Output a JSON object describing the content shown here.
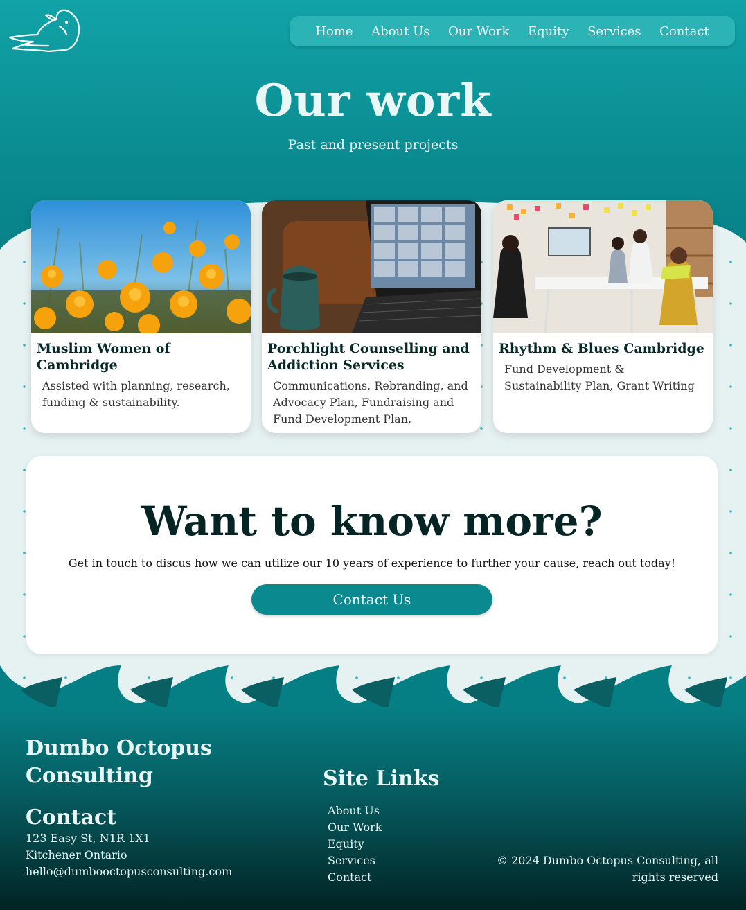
{
  "brand": "Dumbo Octopus Consulting",
  "nav": {
    "items": [
      {
        "label": "Home"
      },
      {
        "label": "About Us"
      },
      {
        "label": "Our Work"
      },
      {
        "label": "Equity"
      },
      {
        "label": "Services"
      },
      {
        "label": "Contact"
      }
    ]
  },
  "hero": {
    "title": "Our work",
    "subtitle": "Past and present projects"
  },
  "projects": [
    {
      "title": "Muslim Women of Cambridge",
      "description": "Assisted with planning, research, funding & sustainability.",
      "image_icon": "flowers-photo"
    },
    {
      "title": "Porchlight Counselling and Addiction Services",
      "description": "Communications, Rebranding, and Advocacy Plan, Fundraising and Fund Development Plan,",
      "image_icon": "laptop-video-call-photo"
    },
    {
      "title": "Rhythm & Blues Cambridge",
      "description": "Fund Development & Sustainability Plan, Grant Writing",
      "image_icon": "team-meeting-photo"
    }
  ],
  "cta": {
    "title": "Want to know more?",
    "text": "Get in touch to discus how we can utilize our 10 years of experience to further your cause, reach out today!",
    "button": "Contact Us"
  },
  "footer": {
    "brand": "Dumbo Octopus Consulting",
    "contact_heading": "Contact",
    "address_line1": "123 Easy St, N1R 1X1",
    "address_line2": "Kitchener Ontario",
    "email": "hello@dumbooctopusconsulting.com",
    "links_heading": "Site Links",
    "links": [
      {
        "label": "About Us"
      },
      {
        "label": "Our Work"
      },
      {
        "label": "Equity"
      },
      {
        "label": "Services"
      },
      {
        "label": "Contact"
      }
    ],
    "copyright": "© 2024 Dumbo Octopus Consulting, all rights reserved"
  },
  "colors": {
    "teal": "#0a8a8f",
    "light_teal": "#2bb3b5",
    "dark": "#062424",
    "background": "#e6f1f1"
  }
}
